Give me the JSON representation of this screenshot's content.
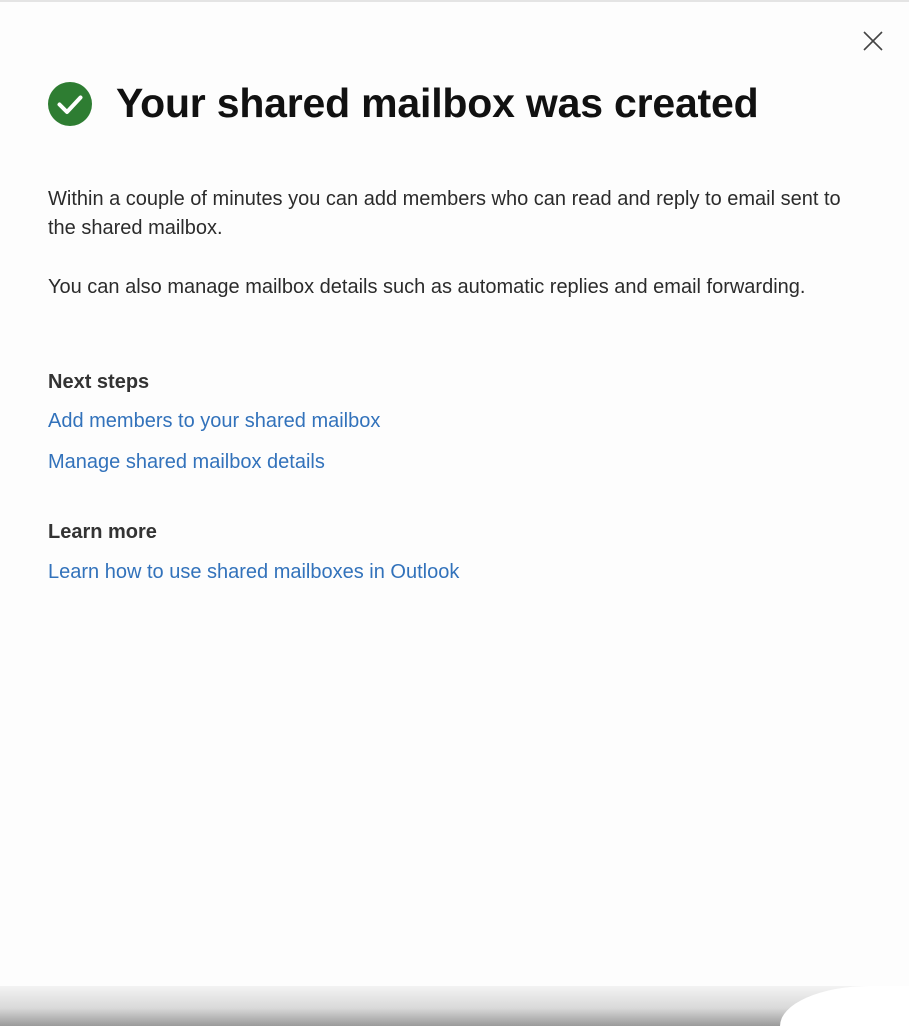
{
  "dialog": {
    "title": "Your shared mailbox was created",
    "status_icon": "check-circle-icon",
    "status_color": "#2e7d32",
    "close_icon": "close-icon",
    "close_label": "Close",
    "paragraphs": [
      "Within a couple of minutes you can add members who can read and reply to email sent to the shared mailbox.",
      "You can also manage mailbox details such as automatic replies and email forwarding."
    ],
    "next_steps": {
      "heading": "Next steps",
      "links": [
        "Add members to your shared mailbox",
        "Manage shared mailbox details"
      ]
    },
    "learn_more": {
      "heading": "Learn more",
      "links": [
        "Learn how to use shared mailboxes in Outlook"
      ]
    },
    "link_color": "#3272bb"
  }
}
